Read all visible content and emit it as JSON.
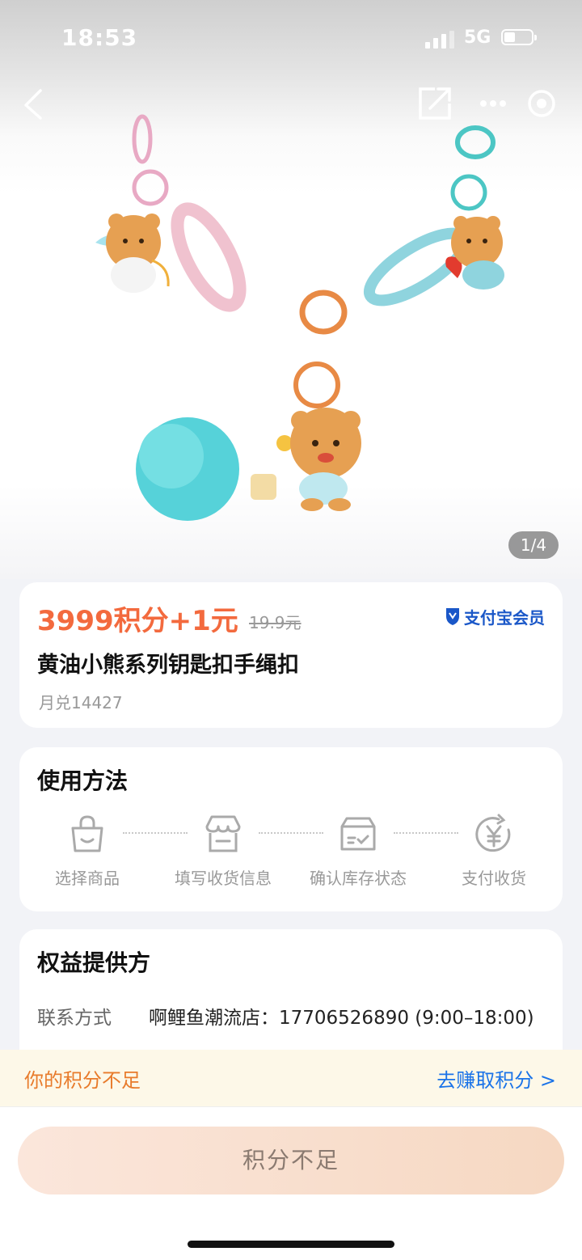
{
  "status_bar": {
    "time": "18:53",
    "network": "5G"
  },
  "gallery": {
    "counter": "1/4"
  },
  "product": {
    "price": "3999积分+1元",
    "original_price": "19.9元",
    "member_badge": "支付宝会员",
    "title": "黄油小熊系列钥匙扣手绳扣",
    "monthly_sales": "月兑14427"
  },
  "usage": {
    "title": "使用方法",
    "steps": [
      {
        "label": "选择商品",
        "icon": "shopping-bag-icon"
      },
      {
        "label": "填写收货信息",
        "icon": "store-icon"
      },
      {
        "label": "确认库存状态",
        "icon": "inventory-box-icon"
      },
      {
        "label": "支付收货",
        "icon": "yuan-payment-icon"
      }
    ]
  },
  "provider": {
    "title": "权益提供方",
    "contact_label": "联系方式",
    "contact_value": "啊鲤鱼潮流店：17706526890 (9:00–18:00)"
  },
  "points_notice": {
    "message": "你的积分不足",
    "link": "去赚取积分 >"
  },
  "action": {
    "button_label": "积分不足"
  },
  "colors": {
    "accent_price": "#f36a3e",
    "link": "#1a73e8",
    "warning": "#e87b2b",
    "member_blue": "#1a57c8"
  }
}
